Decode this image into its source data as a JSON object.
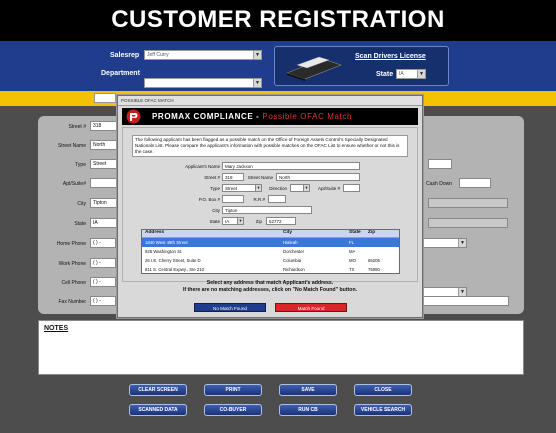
{
  "header": {
    "title": "CUSTOMER REGISTRATION",
    "salesrep_label": "Salesrep",
    "salesrep_value": "Jeff Curry",
    "department_label": "Department",
    "department_value": "",
    "scan_link": "Scan Drivers License",
    "state_label": "State",
    "state_value": "IA"
  },
  "form": {
    "street_no_label": "Street #",
    "street_no": "318",
    "street_name_label": "Street Name",
    "street_name": "North",
    "type_label": "Type",
    "type": "Street",
    "apt_label": "Apt/Suite#",
    "city_label": "City",
    "city": "Tipton",
    "state_label": "State",
    "state": "IA",
    "home_phone_label": "Home Phone",
    "work_phone_label": "Work Phone",
    "cell_phone_label": "Cell Phone",
    "fax_label": "Fax Number",
    "phone_mask": "( ) -",
    "cash_down_label": "Cash Down"
  },
  "notes": {
    "label": "NOTES"
  },
  "buttons": {
    "clear_screen": "CLEAR SCREEN",
    "print": "PRINT",
    "save": "SAVE",
    "close": "CLOSE",
    "scanned_data": "SCANNED DATA",
    "co_buyer": "CO-BUYER",
    "run_cb": "RUN CB",
    "vehicle_search": "VEHICLE SEARCH"
  },
  "modal": {
    "window_title": "POSSIBLE OFAC MATCH",
    "heading_main": "PROMAX COMPLIANCE -",
    "heading_possible": "Possible OFAC Match",
    "notice": "The following applicant has been flagged as a possible match on the Office of Foreign Assets Control's Specially Designated Nationals List.  Please compare the applicant's information with possible matches on the OFAC List to ensure whether or not this is the case.",
    "applicant_name_label": "Applicant's Name",
    "applicant_name": "Mary Jackson",
    "street_no_label": "Street #",
    "street_no": "318",
    "street_name_label": "Street Name",
    "street_name": "North",
    "type_label": "Type",
    "type": "Street",
    "direction_label": "Direction",
    "apt_label": "Apt/Suite #",
    "po_box_label": "P.O. Box #",
    "rr_label": "R.R.#",
    "city_label": "City",
    "city": "Tipton",
    "state_label": "State",
    "state": "IA",
    "zip_label": "Zip",
    "zip": "52772",
    "table_headers": [
      "Address",
      "City",
      "State",
      "Zip"
    ],
    "rows": [
      {
        "address": "1840 West 49th Street",
        "city": "Hialeah",
        "state": "FL",
        "zip": ""
      },
      {
        "address": "925 Washington St.",
        "city": "Dorchester",
        "state": "MA",
        "zip": ""
      },
      {
        "address": "26 I.E. Cherry Street, Suite D",
        "city": "Columbia",
        "state": "MO",
        "zip": "65205"
      },
      {
        "address": "811 S. Central Expwy., Ste 210",
        "city": "Richardson",
        "state": "TX",
        "zip": "75080"
      }
    ],
    "instruction_line1": "Select any address that match Applicant's address.",
    "instruction_line2": "If there are no matching addresses, click on \"No Match Found\" button.",
    "no_match_btn": "No Match Found",
    "match_btn": "Match Found"
  },
  "colors": {
    "header_blue": "#1f3d8c",
    "yellow": "#f2c200",
    "red_accent": "#e3342b",
    "selected_row": "#3a77d8"
  }
}
